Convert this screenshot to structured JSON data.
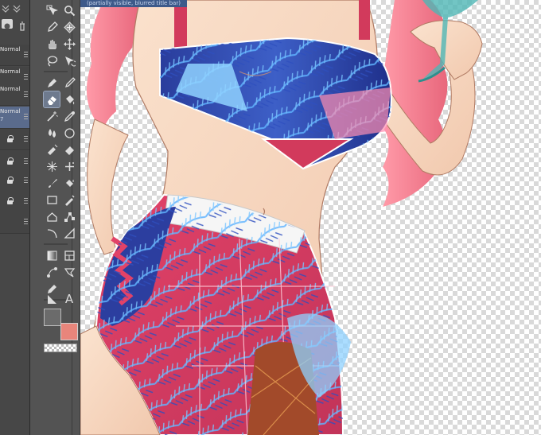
{
  "window": {
    "title": "(partially visible, blurred title bar)"
  },
  "layer_panel": {
    "layers": [
      {
        "mode": "Normal",
        "sub": "",
        "selected": false,
        "locked": false
      },
      {
        "mode": "Normal",
        "sub": "",
        "selected": false,
        "locked": false
      },
      {
        "mode": "Normal",
        "sub": "",
        "selected": false,
        "locked": false
      },
      {
        "mode": "Normal",
        "sub": "7",
        "selected": true,
        "locked": false
      },
      {
        "mode": "",
        "sub": "",
        "selected": false,
        "locked": true
      },
      {
        "mode": "",
        "sub": "",
        "selected": false,
        "locked": true
      },
      {
        "mode": "",
        "sub": "",
        "selected": false,
        "locked": true
      },
      {
        "mode": "",
        "sub": "",
        "selected": false,
        "locked": true
      },
      {
        "mode": "",
        "sub": "",
        "selected": false,
        "locked": false
      }
    ]
  },
  "tools": {
    "text_tool_label": "A",
    "active_tool": "eraser"
  },
  "colors": {
    "main_color": "#6b6b6b",
    "sub_color": "#e8857b",
    "accent": "#5a6b8c"
  }
}
